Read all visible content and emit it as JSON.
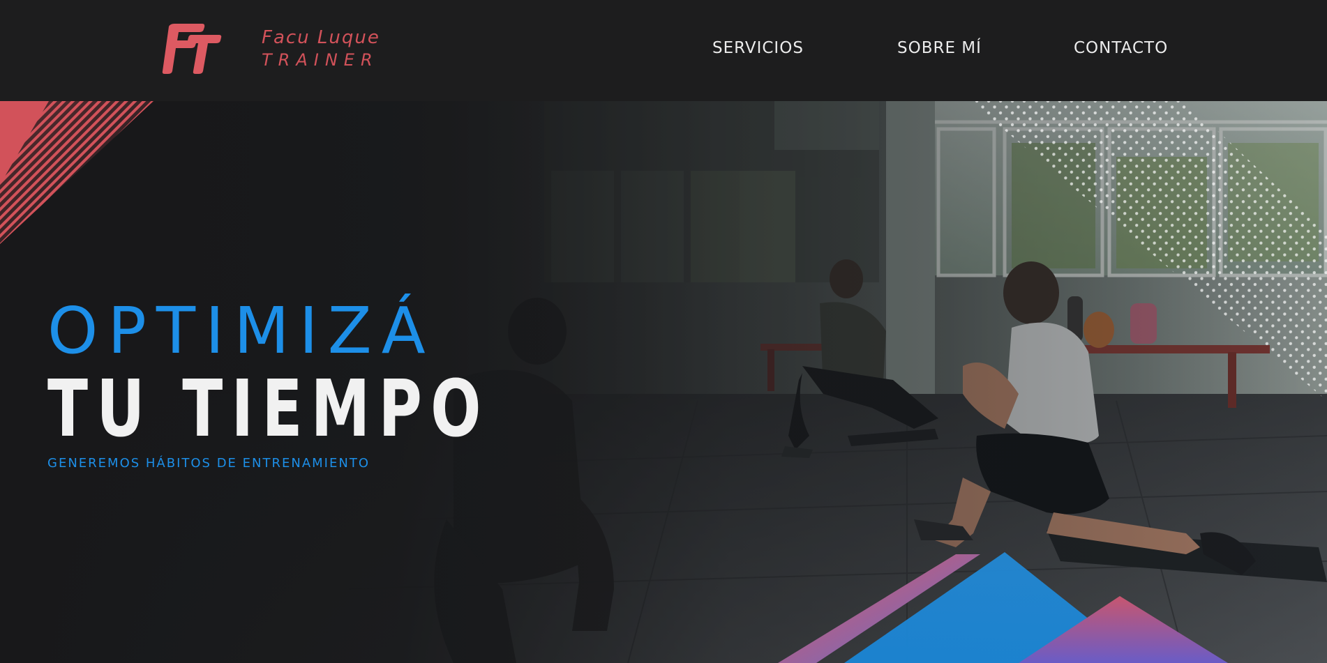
{
  "brand": {
    "name": "Facu Luque",
    "subtitle": "TRAINER",
    "logo_icon": "ft-monogram-icon",
    "accent_color": "#d2525a"
  },
  "nav": {
    "items": [
      {
        "label": "SERVICIOS"
      },
      {
        "label": "SOBRE MÍ"
      },
      {
        "label": "CONTACTO"
      }
    ]
  },
  "hero": {
    "headline_line1": "OPTIMIZÁ",
    "headline_line2": "TU TIEMPO",
    "tagline": "GENEREMOS HÁBITOS DE ENTRENAMIENTO",
    "background_image": "gym-stretching-photo",
    "headline_color": "#1d8fe8",
    "decor": [
      "pink-stripe-corner",
      "dot-pattern-corner",
      "geometric-triangles"
    ]
  }
}
